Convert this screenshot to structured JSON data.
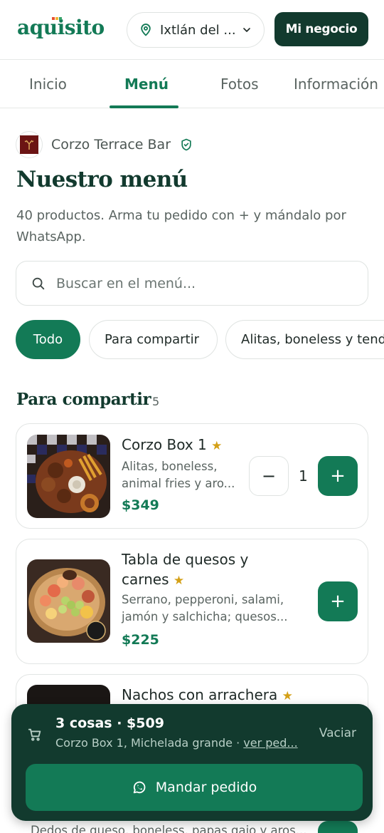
{
  "header": {
    "logo": "aquisito",
    "location": "Ixtlán del ...",
    "business_button": "Mi negocio"
  },
  "tabs": [
    {
      "label": "Inicio",
      "active": false
    },
    {
      "label": "Menú",
      "active": true
    },
    {
      "label": "Fotos",
      "active": false
    },
    {
      "label": "Información",
      "active": false
    }
  ],
  "restaurant": {
    "name": "Corzo Terrace Bar"
  },
  "page": {
    "title": "Nuestro menú",
    "subtitle": "40 productos. Arma tu pedido con + y mándalo por WhatsApp."
  },
  "search": {
    "placeholder": "Buscar en el menú..."
  },
  "categories": [
    {
      "label": "Todo",
      "active": true
    },
    {
      "label": "Para compartir",
      "active": false
    },
    {
      "label": "Alitas, boneless y tenders",
      "active": false
    }
  ],
  "section": {
    "title": "Para compartir",
    "count": "5"
  },
  "products": [
    {
      "name": "Corzo Box 1",
      "star": "★",
      "desc_line1": "Alitas, boneless,",
      "desc_line2": "animal fries y aro...",
      "price": "$349",
      "quantity": "1",
      "minus": "−",
      "plus": "+"
    },
    {
      "name_line1": "Tabla de quesos y",
      "name_line2": "carnes",
      "star": "★",
      "desc_line1": "Serrano, pepperoni, salami,",
      "desc_line2": "jamón y salchicha; quesos...",
      "price": "$225",
      "plus": "+"
    },
    {
      "name": "Nachos con arrachera",
      "star": "★"
    }
  ],
  "peek": {
    "desc": "Dedos de queso, boneless, papas gajo y aros..."
  },
  "cart": {
    "title": "3 cosas · $509",
    "items": "Corzo Box 1, Michelada grande · ",
    "view_link": "ver ped...",
    "clear": "Vaciar",
    "send": "Mandar pedido"
  },
  "colors": {
    "brand_green": "#137a56",
    "dark_green": "#123a2e",
    "star": "#d4a017"
  }
}
